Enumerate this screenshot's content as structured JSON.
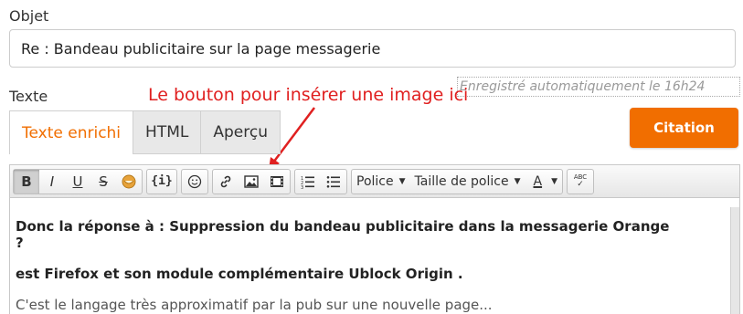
{
  "subject": {
    "label": "Objet",
    "value": "Re : Bandeau publicitaire sur la page messagerie"
  },
  "autosave": "Enregistré automatiquement le 16h24",
  "body_label": "Texte",
  "annotation": "Le bouton pour insérer une image ici",
  "tabs": [
    {
      "label": "Texte enrichi",
      "active": true
    },
    {
      "label": "HTML",
      "active": false
    },
    {
      "label": "Aperçu",
      "active": false
    }
  ],
  "citation_label": "Citation",
  "toolbar": {
    "bold": "B",
    "italic": "I",
    "underline": "U",
    "strike": "S",
    "code": "{i}",
    "font_label": "Police",
    "size_label": "Taille de police",
    "color_label": "A",
    "spellcheck": "ABC"
  },
  "content": {
    "line1": "Donc la réponse à : Suppression du bandeau publicitaire dans la messagerie Orange",
    "line1b": "?",
    "line2": "est Firefox et son module complémentaire Ublock Origin .",
    "line3": "C'est le langage très approximatif par la pub sur une nouvelle page..."
  },
  "colors": {
    "accent": "#f16e00",
    "annotation": "#e02020"
  }
}
